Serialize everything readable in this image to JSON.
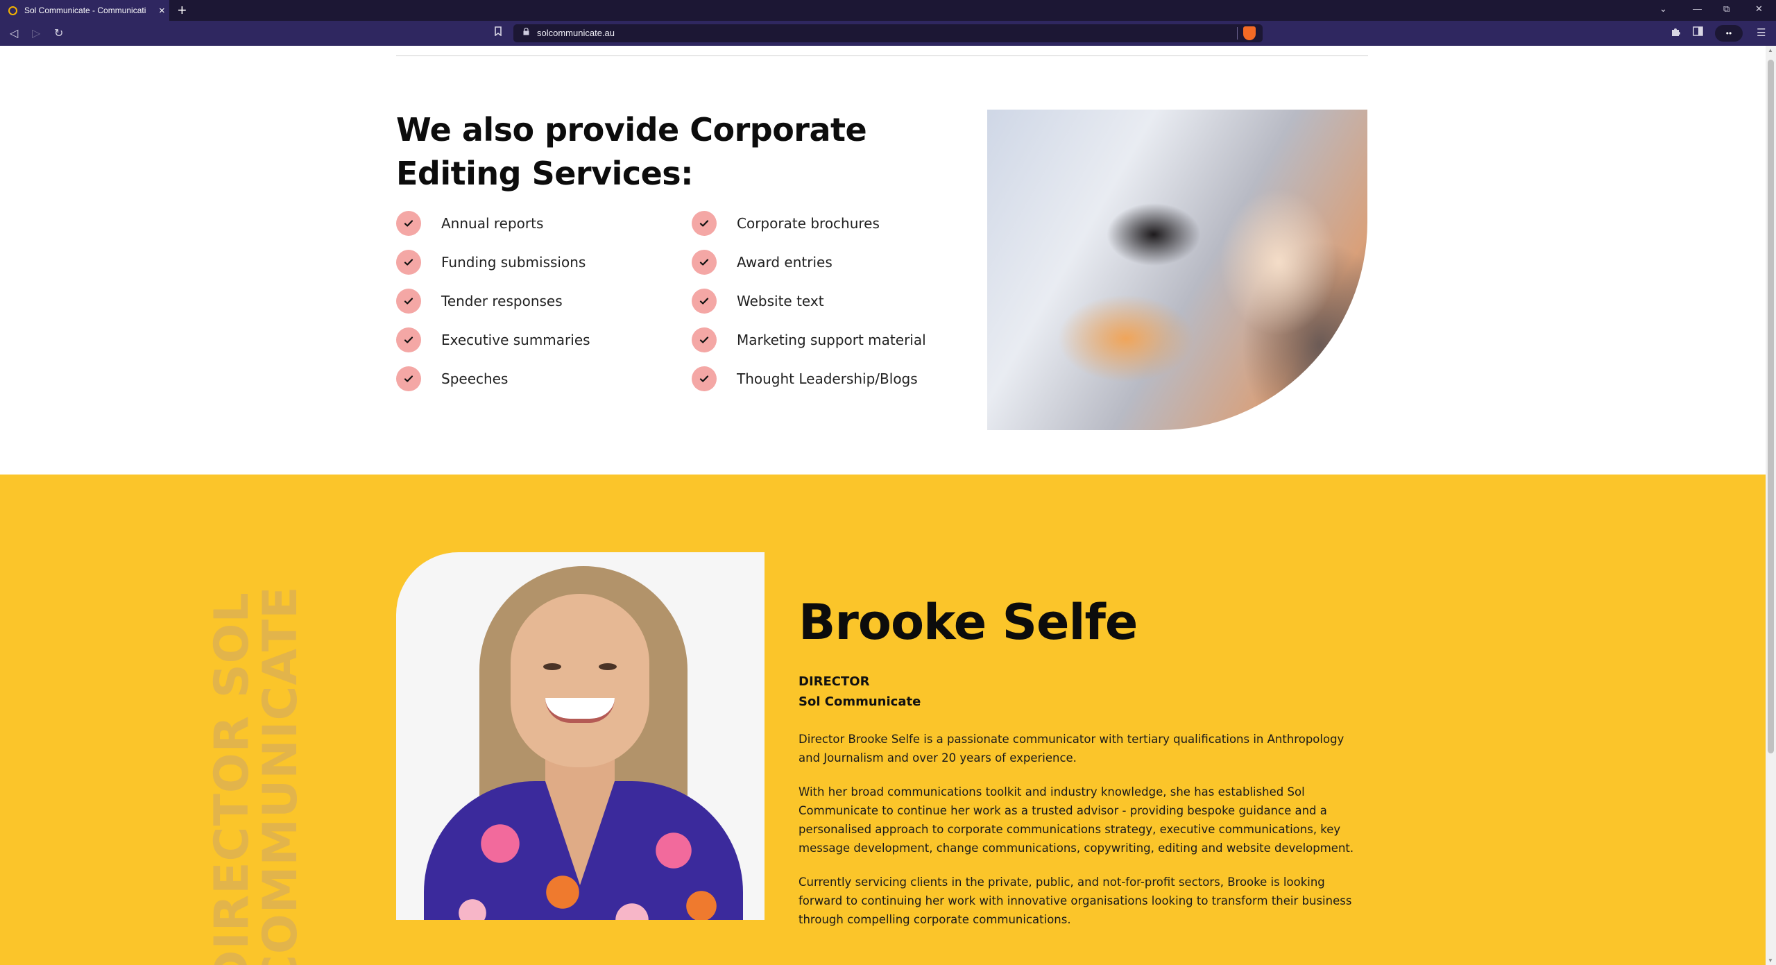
{
  "browser": {
    "tab_title": "Sol Communicate - Communicati",
    "tab_close": "×",
    "new_tab": "+",
    "url": "solcommunicate.au",
    "window_controls": [
      "⌄",
      "—",
      "⧉",
      "✕"
    ],
    "nav": {
      "back": "◁",
      "forward": "▷",
      "reload": "↻"
    },
    "bookmark_icon": "bookmark-icon",
    "extensions_icon": "puzzle-icon",
    "sidebar_icon": "sidebar-icon",
    "menu_icon": "☰",
    "profile": "••"
  },
  "services": {
    "title": "We also provide Corporate Editing Services:",
    "left": [
      "Annual reports",
      "Funding submissions",
      "Tender responses",
      "Executive summaries",
      "Speeches"
    ],
    "right": [
      "Corporate brochures",
      "Award entries",
      "Website text",
      "Marketing support material",
      "Thought Leadership/Blogs"
    ],
    "check_color": "#f4a7a5"
  },
  "director": {
    "background": "#fbc52a",
    "vertical_text": "DIRECTOR SOL COMMUNICATE",
    "name": "Brooke Selfe",
    "role": "DIRECTOR",
    "company": "Sol Communicate",
    "bio": [
      "Director Brooke Selfe is a passionate communicator with tertiary qualifications in Anthropology and Journalism and over 20 years of experience.",
      "With her broad communications toolkit and industry knowledge, she has established Sol Communicate to continue her work as a trusted advisor - providing bespoke guidance and a personalised approach to corporate communications strategy, executive communications, key message development, change communications, copywriting, editing and website development.",
      "Currently servicing clients in the private, public, and not-for-profit sectors, Brooke is looking forward to continuing her work with innovative organisations looking to transform their business through compelling corporate communications."
    ]
  }
}
